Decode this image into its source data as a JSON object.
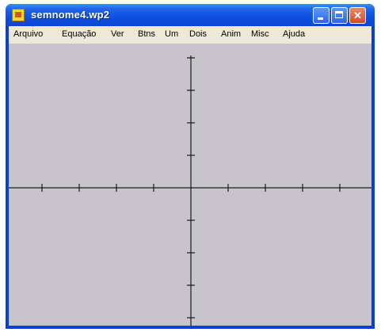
{
  "window": {
    "title": "semnome4.wp2",
    "icon": "winplot-app-icon",
    "controls": {
      "minimize": "minimize-icon",
      "maximize": "maximize-icon",
      "close": "close-icon",
      "close_glyph": "✕"
    }
  },
  "menubar": {
    "items": [
      {
        "label": "Arquivo"
      },
      {
        "label": "Equação"
      },
      {
        "label": "Ver"
      },
      {
        "label": "Btns"
      },
      {
        "label": "Um"
      },
      {
        "label": "Dois"
      },
      {
        "label": "Anim"
      },
      {
        "label": "Misc"
      },
      {
        "label": "Ajuda"
      }
    ]
  },
  "plot": {
    "background": "#c8c4cb",
    "axis_color": "#1a1a1a",
    "x_ticks": 9,
    "y_ticks": 8
  }
}
